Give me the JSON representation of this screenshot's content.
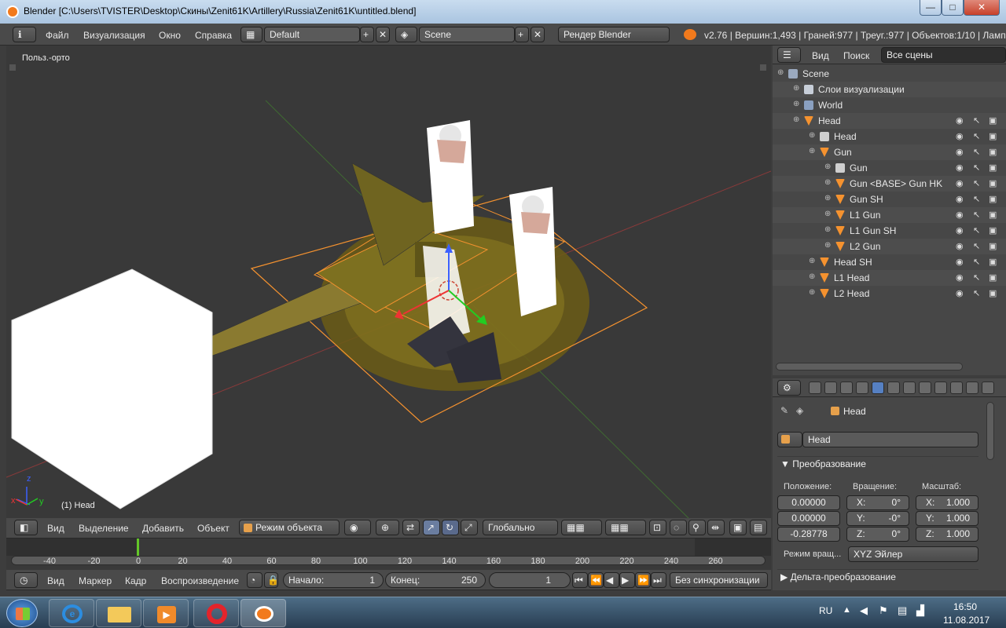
{
  "window": {
    "title": "Blender [C:\\Users\\TVISTER\\Desktop\\Скины\\Zenit61K\\Artillery\\Russia\\Zenit61K\\untitled.blend]",
    "min": "—",
    "max": "□",
    "close": "✕"
  },
  "top_menu": {
    "file": "Файл",
    "render": "Визуализация",
    "window": "Окно",
    "help": "Справка",
    "layout": "Default",
    "scene": "Scene",
    "engine": "Рендер Blender",
    "stats": "v2.76 | Вершин:1,493 | Граней:977 | Треуг.:977 | Объектов:1/10 | Ламп:"
  },
  "viewport": {
    "view_label": "Польз.-орто",
    "object_label": "(1) Head",
    "axis_x": "x",
    "axis_y": "y",
    "axis_z": "z"
  },
  "view_header": {
    "view": "Вид",
    "select": "Выделение",
    "add": "Добавить",
    "object": "Объект",
    "mode": "Режим объекта",
    "orientation": "Глобально"
  },
  "outliner": {
    "view": "Вид",
    "search": "Поиск",
    "filter": "Все сцены",
    "rows": [
      {
        "label": "Scene",
        "indent": 0,
        "icon": "scene"
      },
      {
        "label": "Слои визуализации",
        "indent": 1,
        "icon": "layers"
      },
      {
        "label": "World",
        "indent": 1,
        "icon": "world"
      },
      {
        "label": "Head",
        "indent": 1,
        "icon": "mesh"
      },
      {
        "label": "Head",
        "indent": 2,
        "icon": "data"
      },
      {
        "label": "Gun",
        "indent": 2,
        "icon": "mesh"
      },
      {
        "label": "Gun",
        "indent": 3,
        "icon": "data"
      },
      {
        "label": "Gun <BASE> Gun HK",
        "indent": 3,
        "icon": "mesh"
      },
      {
        "label": "Gun SH",
        "indent": 3,
        "icon": "mesh"
      },
      {
        "label": "L1 Gun",
        "indent": 3,
        "icon": "mesh"
      },
      {
        "label": "L1 Gun SH",
        "indent": 3,
        "icon": "mesh"
      },
      {
        "label": "L2 Gun",
        "indent": 3,
        "icon": "mesh"
      },
      {
        "label": "Head SH",
        "indent": 2,
        "icon": "mesh"
      },
      {
        "label": "L1 Head",
        "indent": 2,
        "icon": "mesh"
      },
      {
        "label": "L2 Head",
        "indent": 2,
        "icon": "mesh"
      }
    ]
  },
  "properties": {
    "breadcrumb": "Head",
    "object_name": "Head",
    "transform_title": "Преобразование",
    "location_label": "Положение:",
    "rotation_label": "Вращение:",
    "scale_label": "Масштаб:",
    "location": [
      "0.00000",
      "0.00000",
      "-0.28778"
    ],
    "rotation": [
      {
        "axis": "X:",
        "value": "0°"
      },
      {
        "axis": "Y:",
        "value": "-0°"
      },
      {
        "axis": "Z:",
        "value": "0°"
      }
    ],
    "scale": [
      {
        "axis": "X:",
        "value": "1.000"
      },
      {
        "axis": "Y:",
        "value": "1.000"
      },
      {
        "axis": "Z:",
        "value": "1.000"
      }
    ],
    "rot_mode_label": "Режим вращ...",
    "rot_mode": "XYZ Эйлер",
    "delta_title": "Дельта-преобразование"
  },
  "timeline": {
    "ticks": [
      "-40",
      "-20",
      "0",
      "20",
      "40",
      "60",
      "80",
      "100",
      "120",
      "140",
      "160",
      "180",
      "200",
      "220",
      "240",
      "260"
    ],
    "view": "Вид",
    "marker": "Маркер",
    "frame": "Кадр",
    "playback": "Воспроизведение",
    "start_label": "Начало:",
    "start": "1",
    "end_label": "Конец:",
    "end": "250",
    "current": "1",
    "sync": "Без синхронизации"
  },
  "taskbar": {
    "lang": "RU",
    "time": "16:50",
    "date": "11.08.2017"
  },
  "colors": {
    "selection": "#f5922f",
    "olive": "#8a7a22"
  }
}
